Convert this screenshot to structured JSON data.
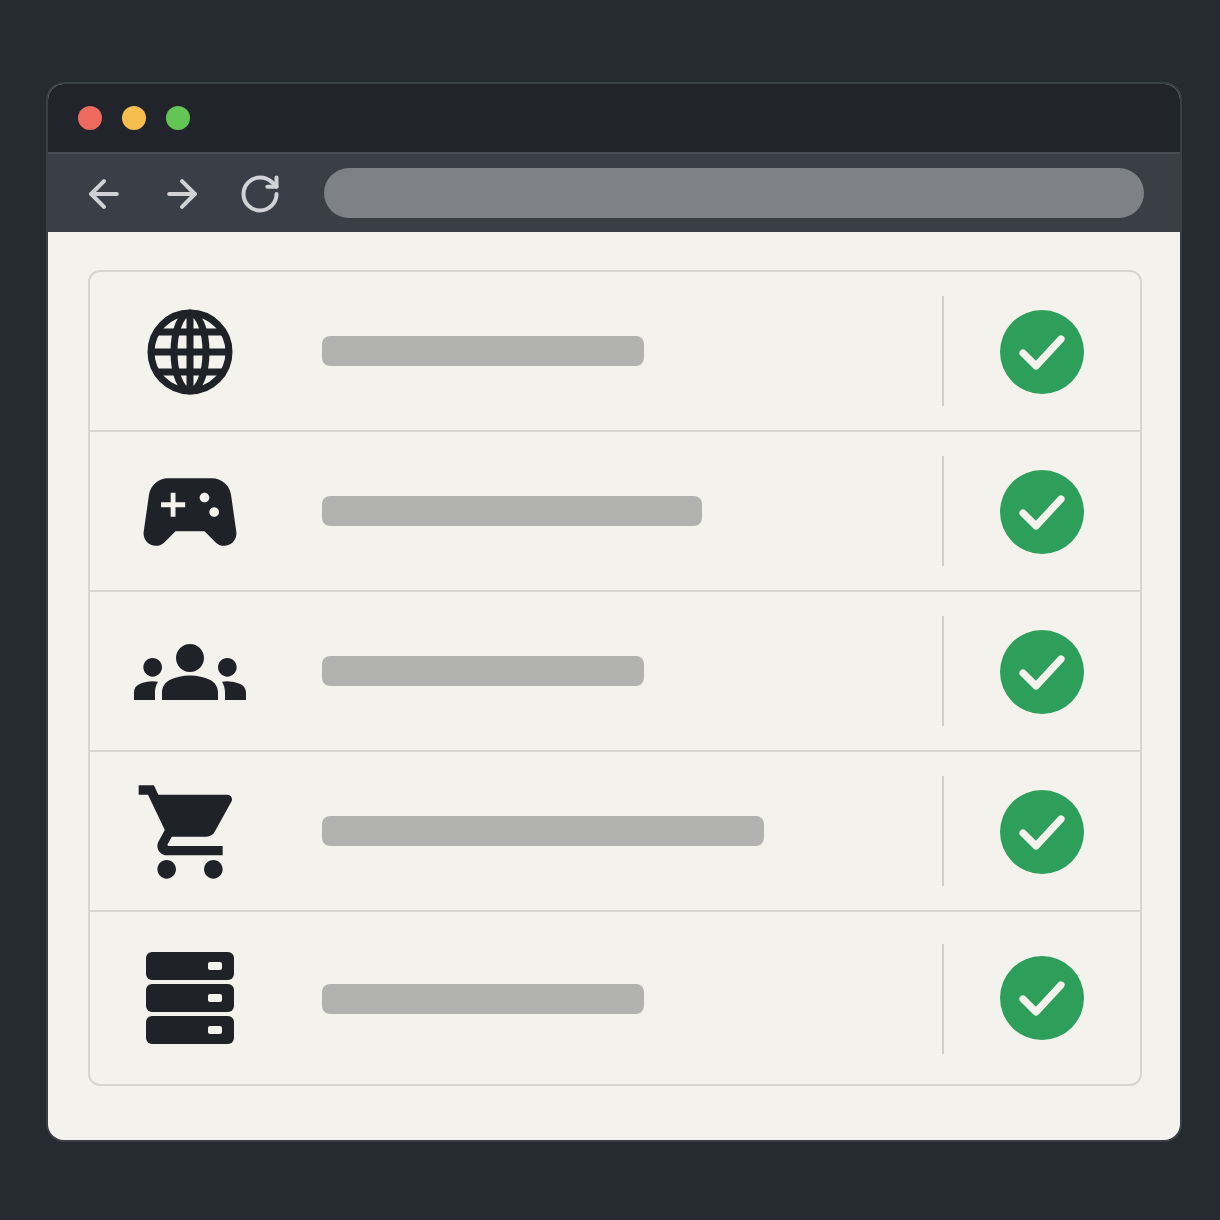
{
  "window": {
    "controls": [
      {
        "color": "#ee6a5f"
      },
      {
        "color": "#f5be4f"
      },
      {
        "color": "#62c554"
      }
    ]
  },
  "toolbar": {
    "buttons": [
      {
        "kind": "back"
      },
      {
        "kind": "forward"
      },
      {
        "kind": "reload"
      }
    ]
  },
  "rows": [
    {
      "kind": "globe",
      "bar": {
        "kind": "short"
      },
      "checked": true
    },
    {
      "kind": "gamepad",
      "bar": {
        "kind": "medium"
      },
      "checked": true
    },
    {
      "kind": "people",
      "bar": {
        "kind": "short"
      },
      "checked": true
    },
    {
      "kind": "cart",
      "bar": {
        "kind": "long"
      },
      "checked": true
    },
    {
      "kind": "server",
      "bar": {
        "kind": "short"
      },
      "checked": true
    }
  ]
}
